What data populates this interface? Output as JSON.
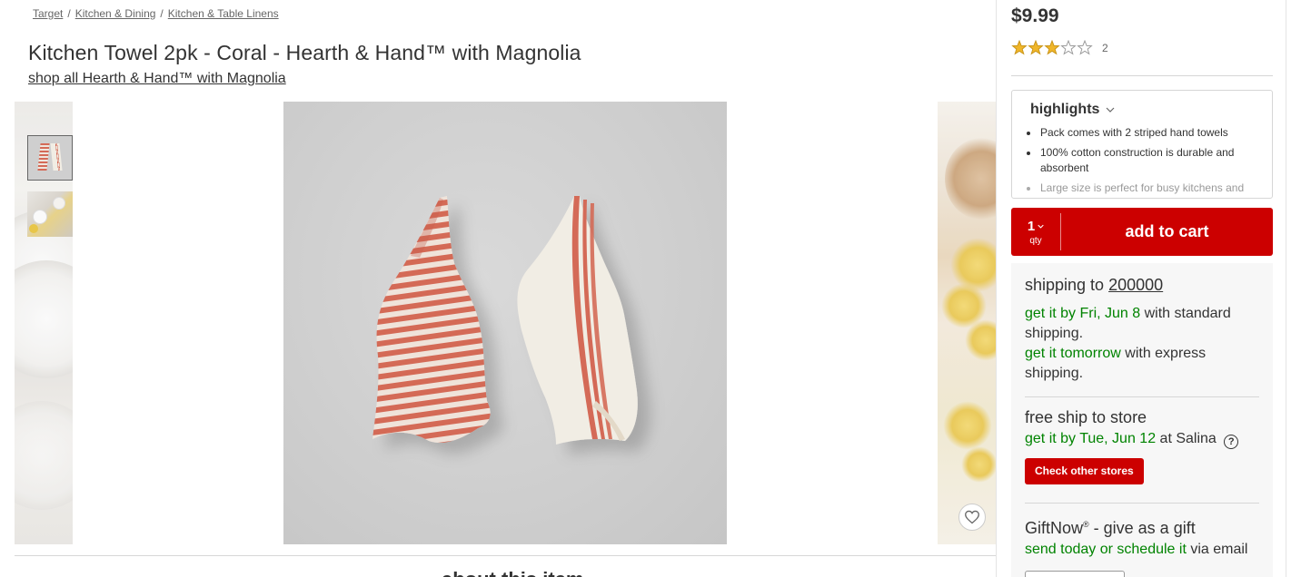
{
  "breadcrumb": [
    "Target",
    "Kitchen & Dining",
    "Kitchen & Table Linens"
  ],
  "breadcrumb_sep": "/",
  "product": {
    "title": "Kitchen Towel 2pk - Coral - Hearth & Hand™ with Magnolia",
    "shop_all": "shop all Hearth & Hand™ with Magnolia"
  },
  "gallery": {
    "thumbnails": [
      "product-towels-thumbnail",
      "table-setting-thumbnail"
    ],
    "selected_index": 0
  },
  "about_heading": "about this item",
  "buy_box": {
    "price": "$9.99",
    "rating": {
      "value": 3,
      "max": 5,
      "count": "2"
    },
    "highlights": {
      "title": "highlights",
      "items": [
        "Pack comes with 2 striped hand towels",
        "100% cotton construction is durable and absorbent",
        "Large size is perfect for busy kitchens and"
      ]
    },
    "qty": {
      "value": "1",
      "label": "qty"
    },
    "add_to_cart": "add to cart",
    "shipping": {
      "title_prefix": "shipping to",
      "zip": "200000",
      "standard_green": "get it by Fri, Jun 8",
      "standard_rest": " with standard shipping.",
      "express_green": "get it tomorrow",
      "express_rest": " with express shipping."
    },
    "store": {
      "title": "free ship to store",
      "green": "get it by Tue, Jun 12",
      "rest": " at Salina",
      "help": "?",
      "button": "Check other stores"
    },
    "gift": {
      "title": "GiftNow",
      "reg": "®",
      "title_rest": " - give as a gift",
      "green": "send today or schedule it",
      "rest": " via email"
    }
  },
  "colors": {
    "accent_red": "#cc0000",
    "success_green": "#008300",
    "star_gold": "#f0b62a",
    "towel_coral": "#d46a57",
    "towel_cream": "#f1ede4"
  }
}
